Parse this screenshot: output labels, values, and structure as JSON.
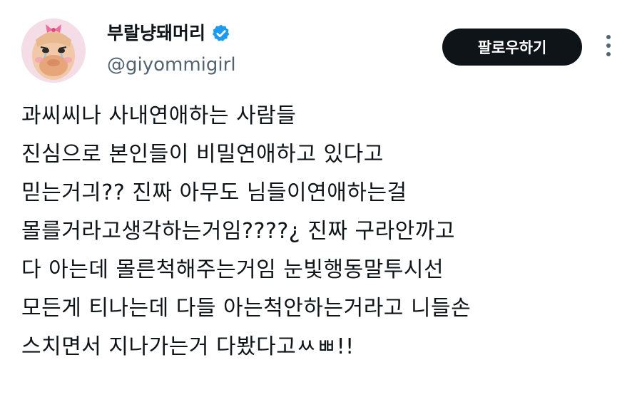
{
  "profile": {
    "display_name": "부랄냥돼머리",
    "handle": "@giyommigirl",
    "verified_icon": "verified-badge-icon",
    "avatar_icon": "avatar-character-icon"
  },
  "actions": {
    "follow_label": "팔로우하기",
    "more_icon": "more-vertical-icon"
  },
  "tweet": {
    "lines": [
      "과씨씨나 사내연애하는 사람들",
      "진심으로 본인들이 비밀연애하고 있다고",
      "믿는거긔?? 진짜 아무도 님들이연애하는걸",
      "몰를거라고생각하는거임????¿ 진짜 구라안까고",
      "다 아는데 몰른척해주는거임 눈빛행동말투시선",
      "모든게 티나는데 다들 아는척안하는거라고 니들손",
      "스치면서 지나가는거 다봤다고ㅆㅃ!!"
    ]
  },
  "colors": {
    "text_primary": "#0f1419",
    "text_secondary": "#536471",
    "follow_bg": "#0f1419",
    "verified_blue": "#1d9bf0"
  }
}
